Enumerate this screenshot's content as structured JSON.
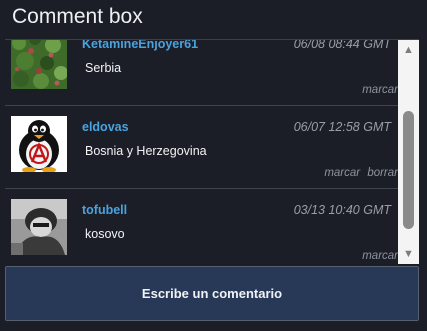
{
  "header": {
    "title": "Comment box"
  },
  "comments": [
    {
      "username": "KetamineEnjoyer61",
      "timestamp": "06/08 08:44 GMT",
      "text": "Serbia",
      "actions": [
        "marcar"
      ],
      "avatar_icon": "foliage-photo-avatar"
    },
    {
      "username": "eldovas",
      "timestamp": "06/07 12:58 GMT",
      "text": "Bosnia y Herzegovina",
      "actions": [
        "marcar",
        "borrar"
      ],
      "avatar_icon": "anarchist-penguin-avatar"
    },
    {
      "username": "tofubell",
      "timestamp": "03/13 10:40 GMT",
      "text": "kosovo",
      "actions": [
        "marcar"
      ],
      "avatar_icon": "grayscale-photo-avatar"
    }
  ],
  "scrollbar": {
    "up_icon": "arrow-up-icon",
    "down_icon": "arrow-down-icon"
  },
  "compose": {
    "label": "Escribe un comentario"
  },
  "colors": {
    "background": "#1b1e27",
    "username": "#4aa3df",
    "button": "#283957"
  }
}
